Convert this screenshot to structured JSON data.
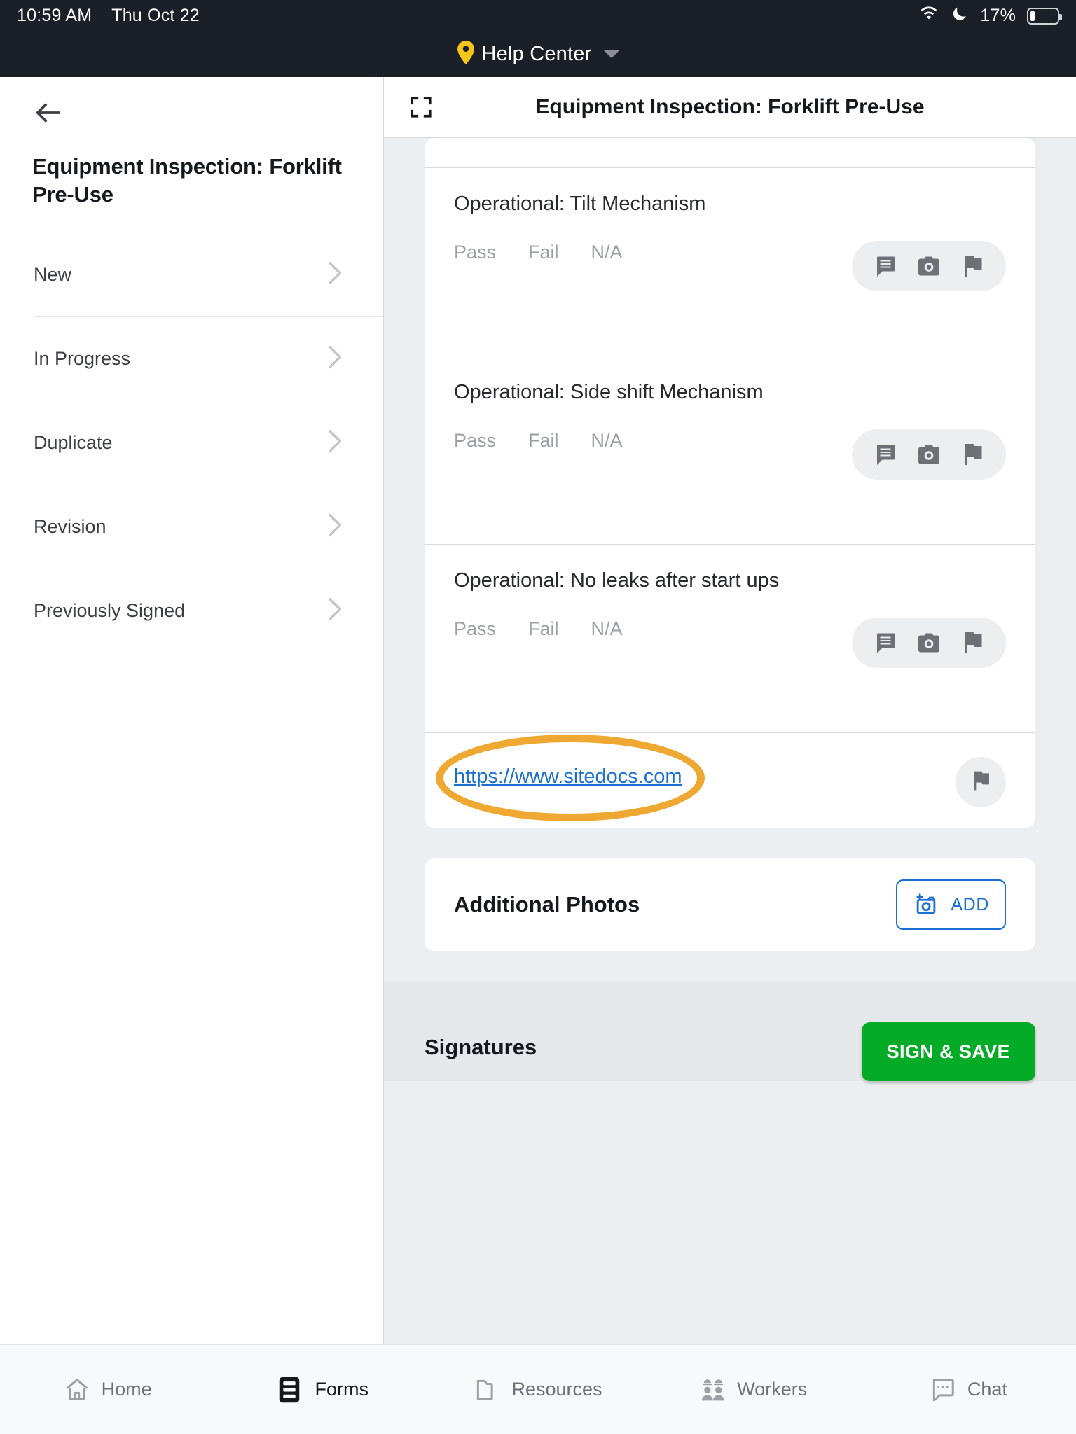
{
  "statusbar": {
    "time": "10:59 AM",
    "date": "Thu Oct 22",
    "battery_percent": "17%",
    "icons": [
      "wifi-icon",
      "do-not-disturb-moon-icon",
      "battery-icon"
    ]
  },
  "appheader": {
    "location_label": "Help Center",
    "pin_icon": "location-pin-icon",
    "dropdown_icon": "chevron-down-icon",
    "accent": "#f5c518"
  },
  "sidebar": {
    "back_icon": "back-arrow-icon",
    "title": "Equipment Inspection: Forklift Pre-Use",
    "items": [
      {
        "label": "New",
        "chevron": "chevron-right-icon"
      },
      {
        "label": "In Progress",
        "chevron": "chevron-right-icon"
      },
      {
        "label": "Duplicate",
        "chevron": "chevron-right-icon"
      },
      {
        "label": "Revision",
        "chevron": "chevron-right-icon"
      },
      {
        "label": "Previously Signed",
        "chevron": "chevron-right-icon"
      }
    ]
  },
  "content": {
    "expand_icon": "fullscreen-expand-icon",
    "title": "Equipment Inspection: Forklift Pre-Use",
    "checklist": [
      {
        "label": "Operational: Tilt Mechanism",
        "options": [
          "Pass",
          "Fail",
          "N/A"
        ],
        "actions": [
          "comment-icon",
          "camera-icon",
          "flag-icon"
        ]
      },
      {
        "label": "Operational: Side shift Mechanism",
        "options": [
          "Pass",
          "Fail",
          "N/A"
        ],
        "actions": [
          "comment-icon",
          "camera-icon",
          "flag-icon"
        ]
      },
      {
        "label": "Operational: No leaks after start ups",
        "options": [
          "Pass",
          "Fail",
          "N/A"
        ],
        "actions": [
          "comment-icon",
          "camera-icon",
          "flag-icon"
        ]
      }
    ],
    "link_row": {
      "url_text": "https://www.sitedocs.com",
      "flag_icon": "flag-icon",
      "annotation": {
        "shape": "ellipse",
        "color": "#efa832"
      }
    },
    "photos": {
      "title": "Additional Photos",
      "add_label": "ADD",
      "add_icon": "add-photo-icon",
      "accent": "#1b6fd4"
    },
    "signatures": {
      "title": "Signatures",
      "sign_save_label": "SIGN & SAVE",
      "accent": "#03ab26"
    }
  },
  "bottomnav": {
    "items": [
      {
        "label": "Home",
        "icon": "home-icon",
        "active": false
      },
      {
        "label": "Forms",
        "icon": "forms-list-icon",
        "active": true
      },
      {
        "label": "Resources",
        "icon": "folder-icon",
        "active": false
      },
      {
        "label": "Workers",
        "icon": "workers-hardhat-icon",
        "active": false
      },
      {
        "label": "Chat",
        "icon": "chat-bubble-icon",
        "active": false
      }
    ]
  }
}
